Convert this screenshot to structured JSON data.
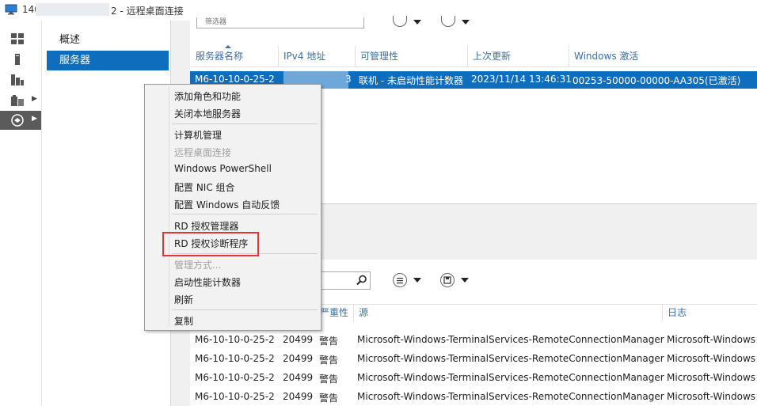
{
  "window": {
    "title_prefix": "140",
    "title_suffix": "2 - 远程桌面连接"
  },
  "nav": {
    "items": [
      {
        "label": "概述",
        "selected": false
      },
      {
        "label": "服务器",
        "selected": true
      }
    ]
  },
  "servers": {
    "filter_placeholder": "筛选器",
    "columns": [
      "服务器名称",
      "IPv4 地址",
      "可管理性",
      "上次更新",
      "Windows 激活"
    ],
    "rows": [
      {
        "name": "M6-10-10-0-25-2",
        "ipv4_suffix": "3",
        "manageability": "联机 - 未启动性能计数器",
        "last_update": "2023/11/14 13:46:31",
        "activation": "00253-50000-00000-AA305(已激活)"
      }
    ]
  },
  "events": {
    "columns": [
      "严重性",
      "源",
      "日志"
    ],
    "rows": [
      {
        "server": "M6-10-10-0-25-2",
        "id": "20499",
        "severity": "警告",
        "source": "Microsoft-Windows-TerminalServices-RemoteConnectionManager",
        "log": "Microsoft-Windows"
      },
      {
        "server": "M6-10-10-0-25-2",
        "id": "20499",
        "severity": "警告",
        "source": "Microsoft-Windows-TerminalServices-RemoteConnectionManager",
        "log": "Microsoft-Windows"
      },
      {
        "server": "M6-10-10-0-25-2",
        "id": "20499",
        "severity": "警告",
        "source": "Microsoft-Windows-TerminalServices-RemoteConnectionManager",
        "log": "Microsoft-Windows"
      },
      {
        "server": "M6-10-10-0-25-2",
        "id": "20499",
        "severity": "警告",
        "source": "Microsoft-Windows-TerminalServices-RemoteConnectionManager",
        "log": "Microsoft-Windows"
      }
    ]
  },
  "context_menu": {
    "items": [
      {
        "label": "添加角色和功能",
        "enabled": true
      },
      {
        "label": "关闭本地服务器",
        "enabled": true
      },
      {
        "label": "计算机管理",
        "enabled": true
      },
      {
        "label": "远程桌面连接",
        "enabled": false
      },
      {
        "label": "Windows PowerShell",
        "enabled": true
      },
      {
        "label": "配置 NIC 组合",
        "enabled": true
      },
      {
        "label": "配置 Windows 自动反馈",
        "enabled": true
      },
      {
        "label": "RD 授权管理器",
        "enabled": true
      },
      {
        "label": "RD 授权诊断程序",
        "enabled": true,
        "highlighted": true
      },
      {
        "label": "管理方式...",
        "enabled": false
      },
      {
        "label": "启动性能计数器",
        "enabled": true
      },
      {
        "label": "刷新",
        "enabled": true
      },
      {
        "label": "复制",
        "enabled": true
      }
    ]
  },
  "colors": {
    "selection": "#0f6dbe",
    "header_text": "#3a6fa8",
    "highlight_box": "#e0363a"
  },
  "icons": [
    "remote-desktop-icon",
    "dashboard-icon",
    "local-server-icon",
    "all-servers-icon",
    "file-storage-icon",
    "remote-desktop-services-icon",
    "search-icon",
    "list-view-icon",
    "save-icon"
  ]
}
